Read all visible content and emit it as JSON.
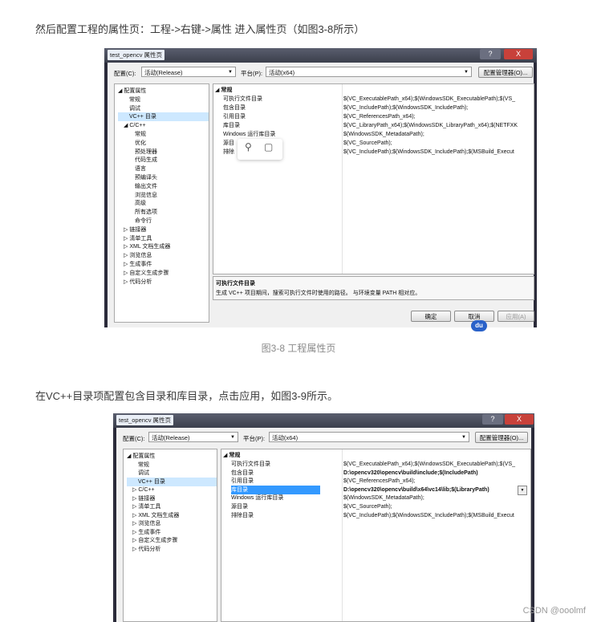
{
  "paragraph1": "然后配置工程的属性页：工程->右键->属性 进入属性页（如图3-8所示）",
  "caption1": "图3-8 工程属性页",
  "paragraph2": "在VC++目录项配置包含目录和库目录，点击应用，如图3-9所示。",
  "watermark": "CSDN @ooolmf",
  "dialog1": {
    "title": "test_opencv 属性页",
    "help_btn": "?",
    "close_btn": "X",
    "config_label": "配置(C):",
    "config_value": "活动(Release)",
    "platform_label": "平台(P):",
    "platform_value": "活动(x64)",
    "config_manager": "配置管理器(O)...",
    "tree": [
      {
        "t": "◢ 配置属性",
        "lv": 0
      },
      {
        "t": "常规",
        "lv": 2
      },
      {
        "t": "调试",
        "lv": 2
      },
      {
        "t": "VC++ 目录",
        "lv": 2,
        "sel": true
      },
      {
        "t": "◢ C/C++",
        "lv": 1
      },
      {
        "t": "常规",
        "lv": 3
      },
      {
        "t": "优化",
        "lv": 3
      },
      {
        "t": "预处理器",
        "lv": 3
      },
      {
        "t": "代码生成",
        "lv": 3
      },
      {
        "t": "语言",
        "lv": 3
      },
      {
        "t": "预编译头",
        "lv": 3
      },
      {
        "t": "输出文件",
        "lv": 3
      },
      {
        "t": "浏览信息",
        "lv": 3
      },
      {
        "t": "高级",
        "lv": 3
      },
      {
        "t": "所有选项",
        "lv": 3
      },
      {
        "t": "命令行",
        "lv": 3
      },
      {
        "t": "▷ 链接器",
        "lv": 1
      },
      {
        "t": "▷ 清单工具",
        "lv": 1
      },
      {
        "t": "▷ XML 文档生成器",
        "lv": 1
      },
      {
        "t": "▷ 浏览信息",
        "lv": 1
      },
      {
        "t": "▷ 生成事件",
        "lv": 1
      },
      {
        "t": "▷ 自定义生成步骤",
        "lv": 1
      },
      {
        "t": "▷ 代码分析",
        "lv": 1
      }
    ],
    "section": "◢ 常规",
    "rows": [
      {
        "k": "可执行文件目录",
        "v": "$(VC_ExecutablePath_x64);$(WindowsSDK_ExecutablePath);$(VS_"
      },
      {
        "k": "包含目录",
        "v": "$(VC_IncludePath);$(WindowsSDK_IncludePath);"
      },
      {
        "k": "引用目录",
        "v": "$(VC_ReferencesPath_x64);"
      },
      {
        "k": "库目录",
        "v": "$(VC_LibraryPath_x64);$(WindowsSDK_LibraryPath_x64);$(NETFXK"
      },
      {
        "k": "Windows 运行库目录",
        "v": "$(WindowsSDK_MetadataPath);"
      },
      {
        "k": "源目",
        "v": "$(VC_SourcePath);"
      },
      {
        "k": "排除",
        "v": "$(VC_IncludePath);$(WindowsSDK_IncludePath);$(MSBuild_Execut"
      }
    ],
    "desc_title": "可执行文件目录",
    "desc_text": "生成 VC++ 项目期间，搜索可执行文件时使用的路径。 与环境变量 PATH 相对应。",
    "ok": "确定",
    "cancel": "取消",
    "apply": "应用(A)",
    "popup_icons": [
      "search-icon",
      "comment-icon"
    ]
  },
  "dialog2": {
    "title": "test_opencv 属性页",
    "help_btn": "?",
    "close_btn": "X",
    "config_label": "配置(C):",
    "config_value": "活动(Release)",
    "platform_label": "平台(P):",
    "platform_value": "活动(x64)",
    "config_manager": "配置管理器(O)...",
    "tree": [
      {
        "t": "◢ 配置属性",
        "lv": 0
      },
      {
        "t": "常规",
        "lv": 2
      },
      {
        "t": "调试",
        "lv": 2
      },
      {
        "t": "VC++ 目录",
        "lv": 2,
        "sel": true
      },
      {
        "t": "▷ C/C++",
        "lv": 1
      },
      {
        "t": "▷ 链接器",
        "lv": 1
      },
      {
        "t": "▷ 清单工具",
        "lv": 1
      },
      {
        "t": "▷ XML 文档生成器",
        "lv": 1
      },
      {
        "t": "▷ 浏览信息",
        "lv": 1
      },
      {
        "t": "▷ 生成事件",
        "lv": 1
      },
      {
        "t": "▷ 自定义生成步骤",
        "lv": 1
      },
      {
        "t": "▷ 代码分析",
        "lv": 1
      }
    ],
    "section": "◢ 常规",
    "rows": [
      {
        "k": "可执行文件目录",
        "v": "$(VC_ExecutablePath_x64);$(WindowsSDK_ExecutablePath);$(VS_"
      },
      {
        "k": "包含目录",
        "v": "D:\\opencv320\\opencv\\build\\include;$(IncludePath)",
        "bold": true
      },
      {
        "k": "引用目录",
        "v": "$(VC_ReferencesPath_x64);"
      },
      {
        "k": "库目录",
        "v": "D:\\opencv320\\opencv\\build\\x64\\vc14\\lib;$(LibraryPath)",
        "bold": true,
        "sel": true
      },
      {
        "k": "Windows 运行库目录",
        "v": "$(WindowsSDK_MetadataPath);"
      },
      {
        "k": "源目录",
        "v": "$(VC_SourcePath);"
      },
      {
        "k": "排除目录",
        "v": "$(VC_IncludePath);$(WindowsSDK_IncludePath);$(MSBuild_Execut"
      }
    ]
  }
}
